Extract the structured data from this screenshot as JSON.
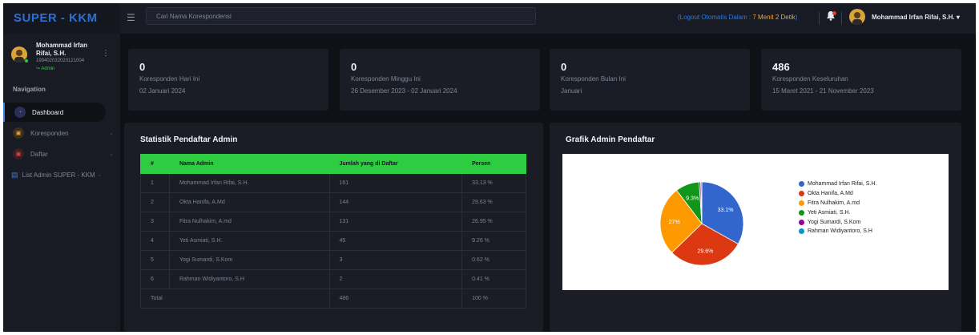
{
  "brand": "SUPER - KKM",
  "search": {
    "placeholder": "Cari Nama Korespondensi"
  },
  "logout": {
    "prefix": "(Logout Otomatis Dalam : ",
    "timer": "7 Menit 2 Detik",
    "suffix": ")"
  },
  "user": {
    "name": "Mohammad Irfan Rifai, S.H.",
    "nip": "199402032020121004",
    "role": "Admin"
  },
  "sidebar": {
    "nav_title": "Navigation",
    "items": [
      {
        "label": "Dashboard",
        "active": true
      },
      {
        "label": "Koresponden",
        "active": false
      },
      {
        "label": "Daftar",
        "active": false
      },
      {
        "label": "List Admin SUPER - KKM",
        "active": false
      }
    ]
  },
  "stats": [
    {
      "value": "0",
      "label": "Koresponden Hari Ini",
      "date": "02 Januari 2024"
    },
    {
      "value": "0",
      "label": "Koresponden Minggu Ini",
      "date": "26 Desember 2023 - 02 Januari 2024"
    },
    {
      "value": "0",
      "label": "Koresponden Bulan Ini",
      "date": "Januari"
    },
    {
      "value": "486",
      "label": "Koresponden Keseluruhan",
      "date": "15 Maret 2021 - 21 November 2023"
    }
  ],
  "table_panel": {
    "title": "Statistik Pendaftar Admin",
    "headers": [
      "#",
      "Nama Admin",
      "Jumlah yang di Daftar",
      "Persen"
    ],
    "rows": [
      [
        "1",
        "Mohammad Irfan Rifai, S.H.",
        "161",
        "33.13 %"
      ],
      [
        "2",
        "Okta Hanifa, A.Md",
        "144",
        "29.63 %"
      ],
      [
        "3",
        "Fitra Nulhakim, A.md",
        "131",
        "26.95 %"
      ],
      [
        "4",
        "Yeti Asmiati, S.H.",
        "45",
        "9.26 %"
      ],
      [
        "5",
        "Yogi Sumardi, S.Kom",
        "3",
        "0.62 %"
      ],
      [
        "6",
        "Rahman Widiyantoro, S.H",
        "2",
        "0.41 %"
      ]
    ],
    "total": {
      "label": "Total",
      "count": "486",
      "percent": "100 %"
    }
  },
  "chart_panel": {
    "title": "Grafik Admin Pendaftar"
  },
  "chart_data": {
    "type": "pie",
    "labels": [
      "Mohammad Irfan Rifai, S.H.",
      "Okta Hanifa, A.Md",
      "Fitra Nulhakim, A.md",
      "Yeti Asmiati, S.H.",
      "Yogi Sumardi, S.Kom",
      "Rahman Widiyantoro, S.H"
    ],
    "values": [
      161,
      144,
      131,
      45,
      3,
      2
    ],
    "slice_labels": [
      "33.1%",
      "29.6%",
      "27%",
      "9.3%",
      "",
      ""
    ],
    "colors": [
      "#3366cc",
      "#dc3912",
      "#ff9900",
      "#109618",
      "#990099",
      "#0099c6"
    ],
    "legend_position": "right"
  }
}
